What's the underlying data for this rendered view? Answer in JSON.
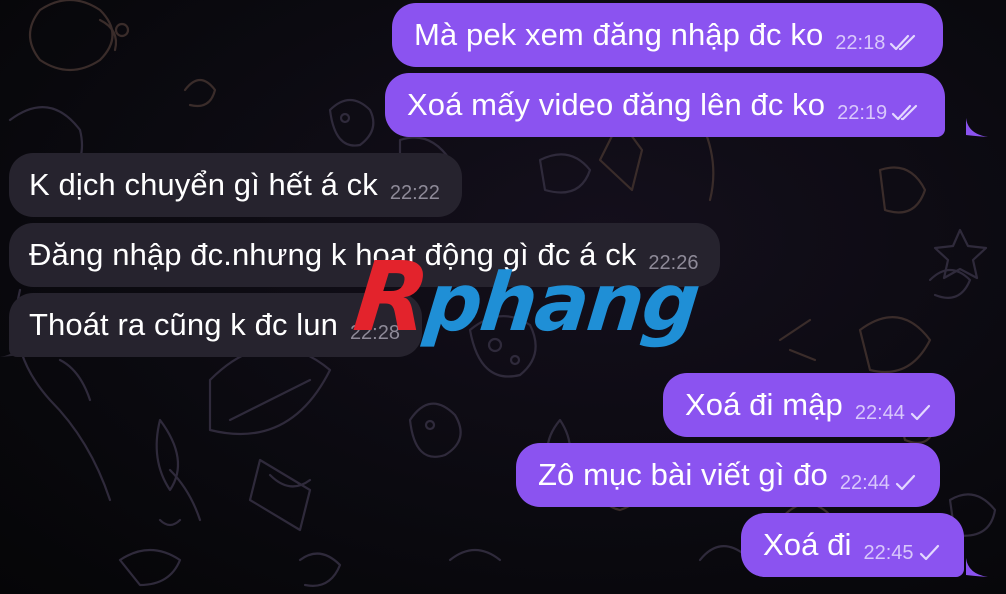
{
  "colors": {
    "background": "#0b0a10",
    "outgoing_bubble": "#8b53f0",
    "incoming_bubble": "#26232e",
    "doodle_stroke": "#2f2a3b",
    "watermark_r": "#e3232c",
    "watermark_text": "#1f8fd6"
  },
  "watermark": {
    "r": "R",
    "rest": "phang"
  },
  "messages": [
    {
      "direction": "outgoing",
      "text": "Mà pek xem đăng nhập đc ko",
      "time": "22:18",
      "status": "read-double-check-icon"
    },
    {
      "direction": "outgoing",
      "text": "Xoá mấy video đăng lên đc ko",
      "time": "22:19",
      "status": "read-double-check-icon"
    },
    {
      "direction": "incoming",
      "text": "K dịch chuyển gì hết á ck",
      "time": "22:22"
    },
    {
      "direction": "incoming",
      "text": "Đăng nhập đc.nhưng k hoạt động gì đc á ck",
      "time": "22:26"
    },
    {
      "direction": "incoming",
      "text": "Thoát ra cũng k đc lun",
      "time": "22:28"
    },
    {
      "direction": "outgoing",
      "text": "Xoá đi mập",
      "time": "22:44",
      "status": "sent-check-icon"
    },
    {
      "direction": "outgoing",
      "text": "Zô mục bài viết gì đo",
      "time": "22:44",
      "status": "sent-check-icon"
    },
    {
      "direction": "outgoing",
      "text": "Xoá đi",
      "time": "22:45",
      "status": "sent-check-icon"
    }
  ]
}
